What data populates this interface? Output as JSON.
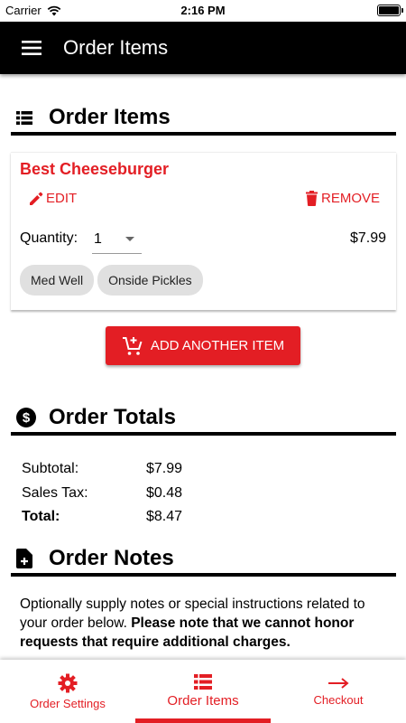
{
  "status_bar": {
    "carrier": "Carrier",
    "time": "2:16 PM"
  },
  "app_bar": {
    "title": "Order Items",
    "menu_icon": "hamburger-menu-icon"
  },
  "order_items": {
    "heading": "Order Items",
    "icon": "list-icon",
    "items": [
      {
        "name": "Best Cheeseburger",
        "edit_label": "EDIT",
        "remove_label": "REMOVE",
        "quantity_label": "Quantity:",
        "quantity_value": "1",
        "price": "$7.99",
        "modifiers": [
          "Med Well",
          "Onside Pickles"
        ]
      }
    ],
    "add_button_label": "ADD ANOTHER ITEM"
  },
  "order_totals": {
    "heading": "Order Totals",
    "icon": "dollar-circle-icon",
    "rows": [
      {
        "label": "Subtotal:",
        "value": "$7.99"
      },
      {
        "label": "Sales Tax:",
        "value": "$0.48"
      },
      {
        "label": "Total:",
        "value": "$8.47"
      }
    ]
  },
  "order_notes": {
    "heading": "Order Notes",
    "icon": "note-add-icon",
    "text": "Optionally supply notes or special instructions related to your order below.",
    "bold_text": "Please note that we cannot honor requests that require additional charges."
  },
  "bottom_nav": {
    "tabs": [
      {
        "label": "Order Settings",
        "icon": "gear-icon",
        "active": false
      },
      {
        "label": "Order Items",
        "icon": "list-icon",
        "active": true
      },
      {
        "label": "Checkout",
        "icon": "arrow-right-icon",
        "active": false
      }
    ]
  },
  "colors": {
    "accent": "#e31e24",
    "app_bar": "#000000",
    "chip": "#e0e0e0"
  }
}
